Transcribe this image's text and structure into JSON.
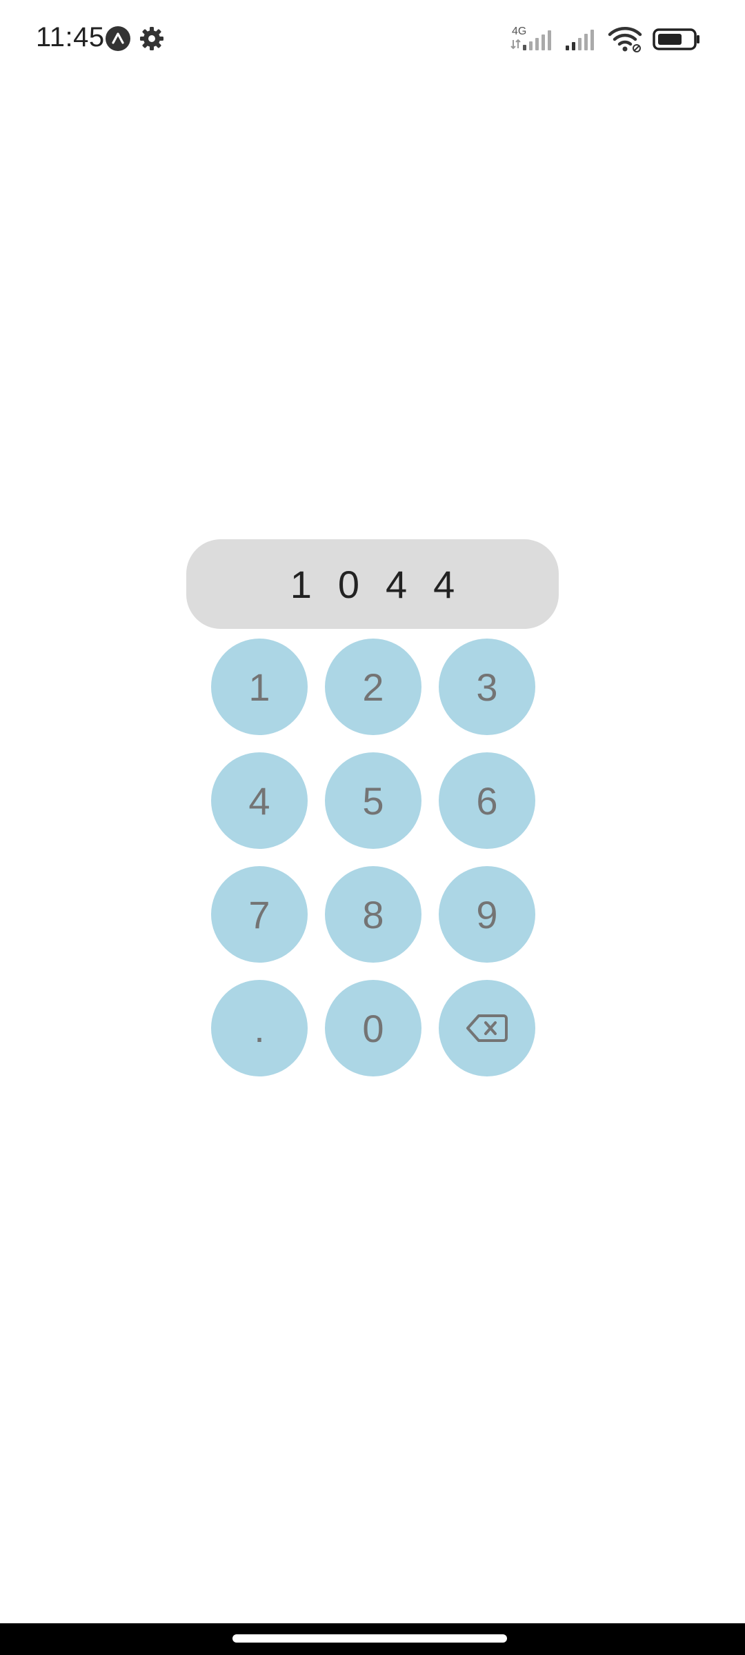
{
  "status_bar": {
    "time": "11:45",
    "network_label": "4G",
    "icons": [
      "app-notification-icon",
      "gear-icon",
      "mobile-data-4g-icon",
      "cell-signal-icon",
      "wifi-icon",
      "battery-icon"
    ]
  },
  "display": {
    "value": "1044"
  },
  "keypad": {
    "keys": [
      "1",
      "2",
      "3",
      "4",
      "5",
      "6",
      "7",
      "8",
      "9",
      ".",
      "0"
    ],
    "backspace_icon": "backspace-icon"
  },
  "colors": {
    "key_background": "#acd6e5",
    "key_text": "#747474",
    "display_background": "#dcdcdc",
    "display_text": "#222222",
    "nav_bar": "#000000"
  }
}
